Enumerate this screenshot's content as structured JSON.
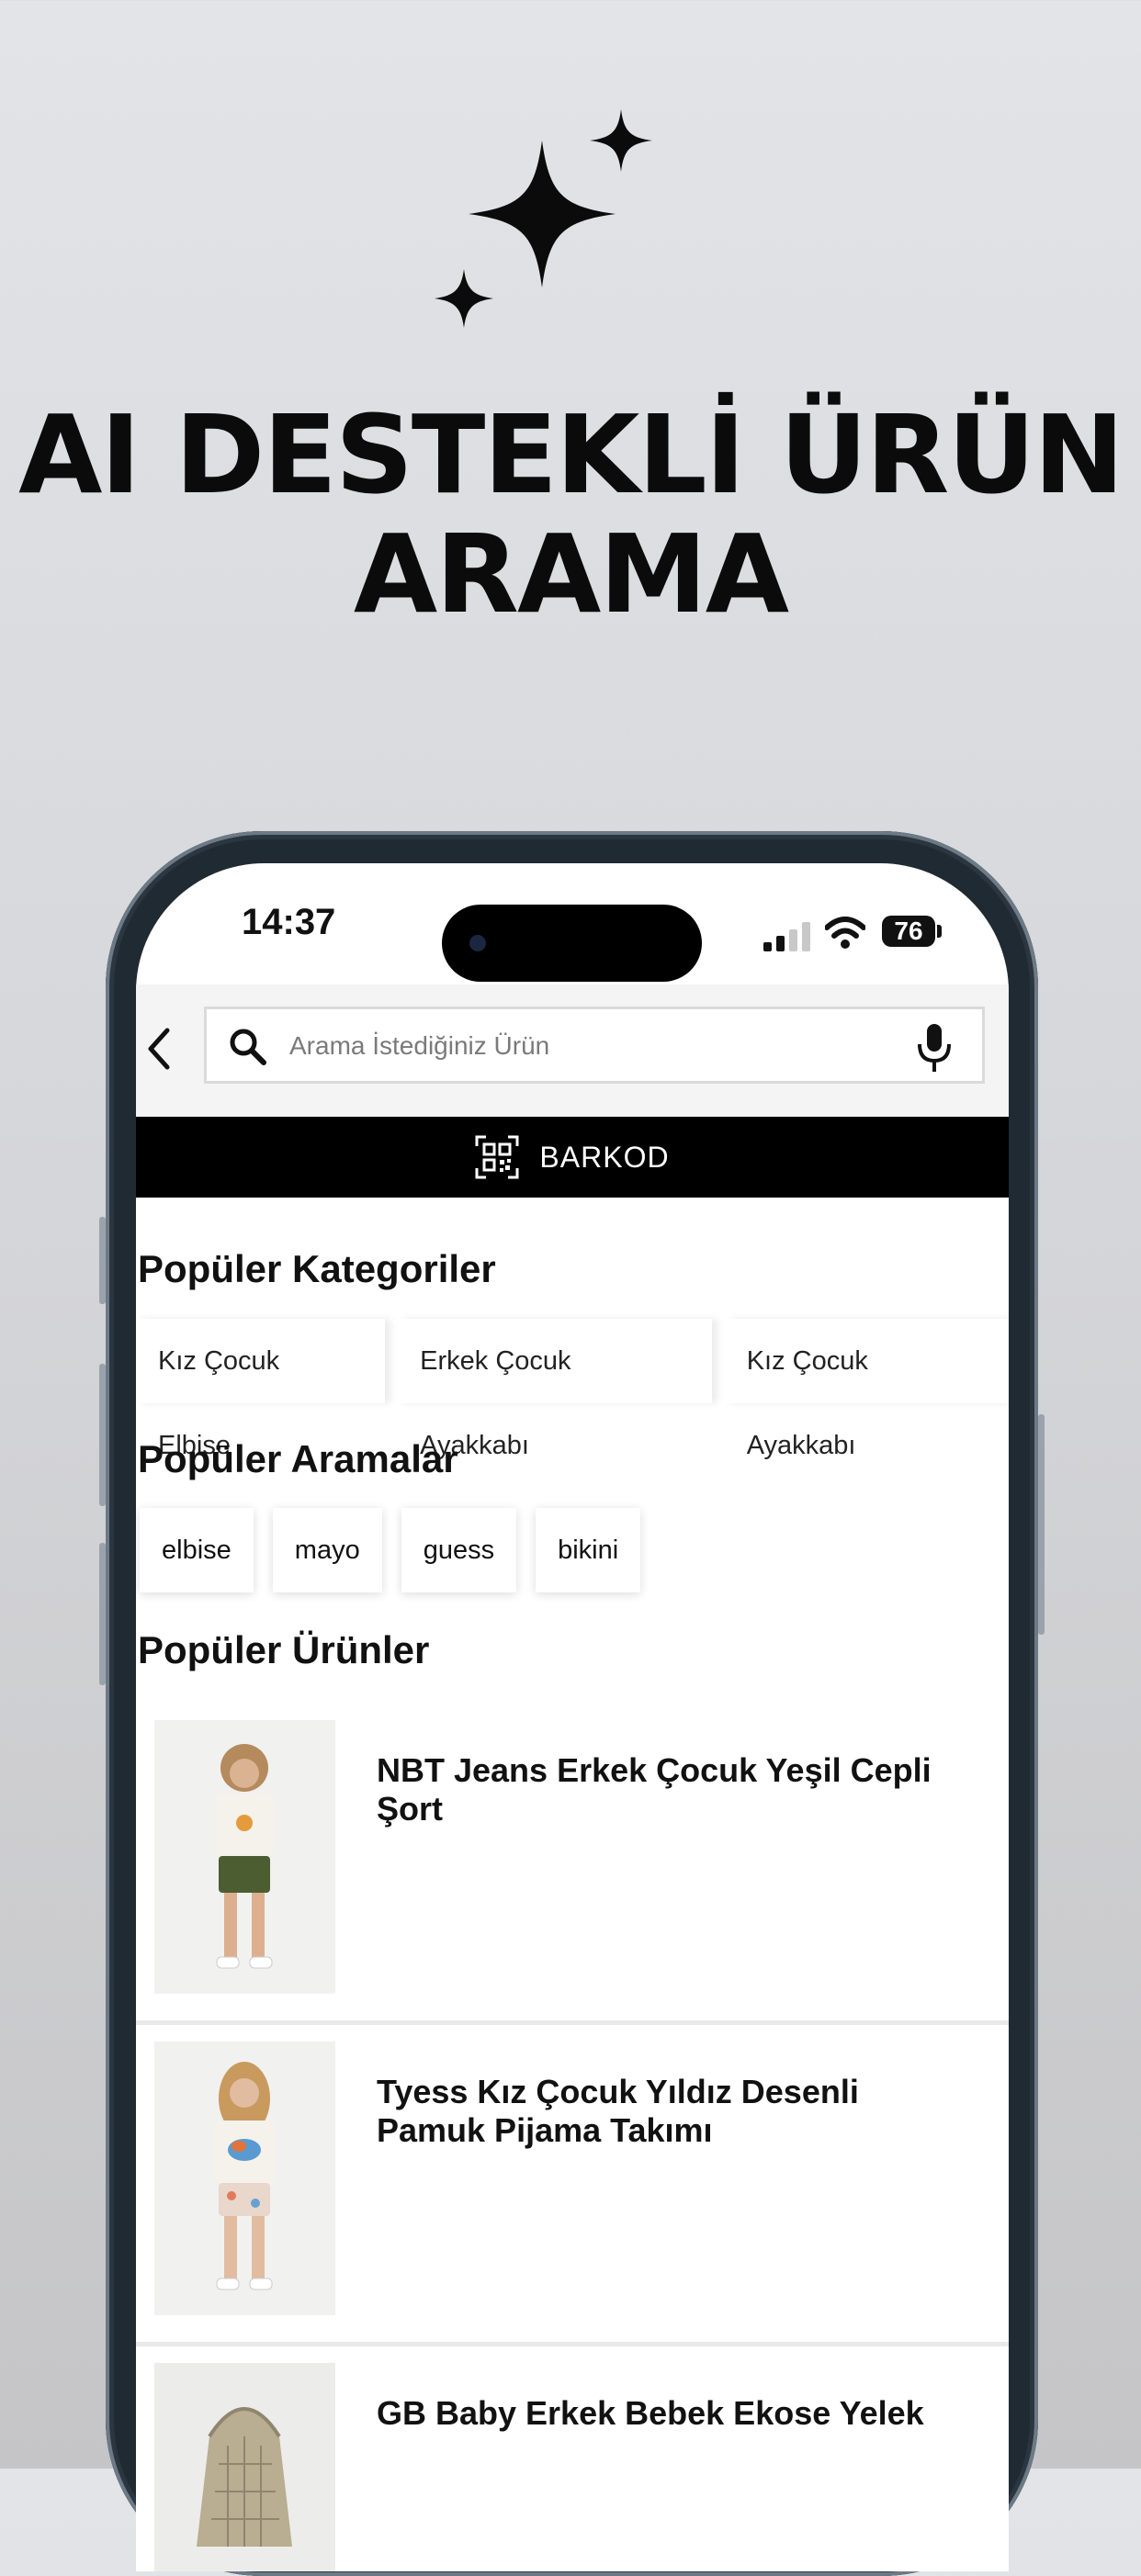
{
  "promo": {
    "headline_line1": "AI DESTEKLİ ÜRÜN",
    "headline_line2": "ARAMA",
    "icon": "sparkles-icon"
  },
  "status_bar": {
    "time": "14:37",
    "battery": "76"
  },
  "search": {
    "placeholder": "Arama İstediğiniz Ürün",
    "back_icon": "chevron-left-icon",
    "mic_icon": "microphone-icon"
  },
  "barcode": {
    "label": "BARKOD",
    "icon": "qr-code-icon"
  },
  "popular_categories": {
    "title": "Popüler Kategoriler",
    "items": [
      "Kız Çocuk Elbise",
      "Erkek Çocuk Ayakkabı",
      "Kız Çocuk Ayakkabı"
    ]
  },
  "popular_searches": {
    "title": "Popüler Aramalar",
    "items": [
      "elbise",
      "mayo",
      "guess",
      "bikini"
    ]
  },
  "popular_products": {
    "title": "Popüler Ürünler",
    "items": [
      {
        "name": "NBT Jeans Erkek Çocuk Yeşil Cepli Şort"
      },
      {
        "name": "Tyess Kız Çocuk Yıldız Desenli Pamuk Pijama Takımı"
      },
      {
        "name": "GB Baby Erkek Bebek Ekose Yelek"
      }
    ]
  }
}
